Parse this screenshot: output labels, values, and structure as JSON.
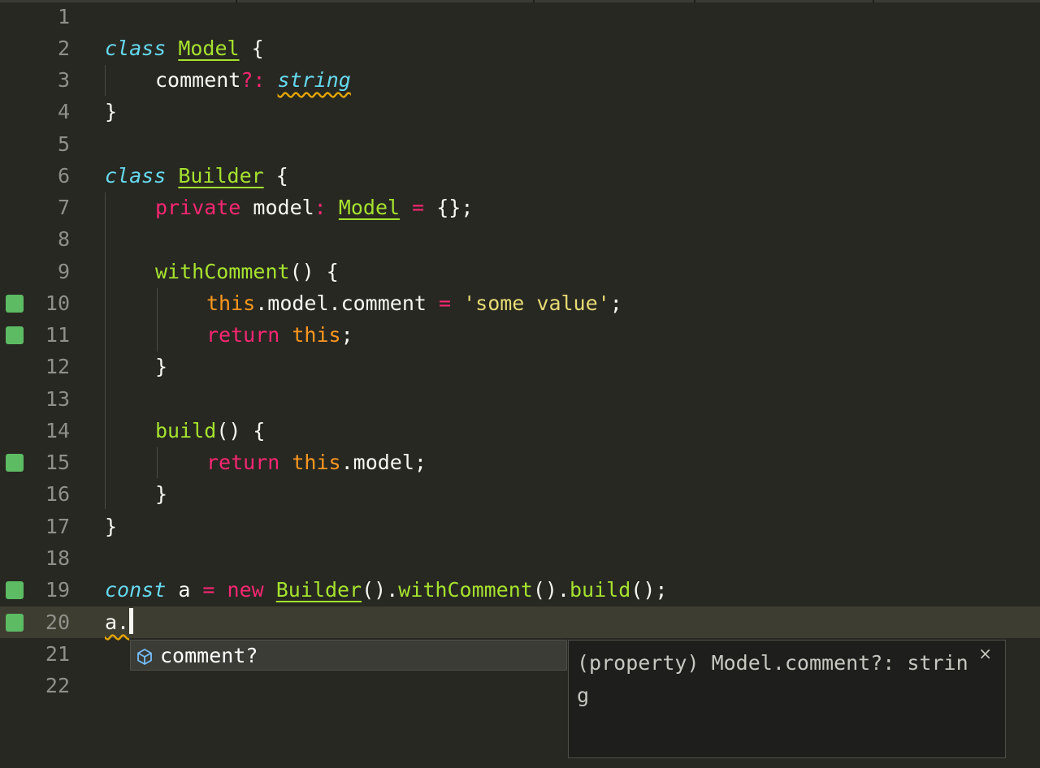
{
  "editor": {
    "line_numbers": [
      "1",
      "2",
      "3",
      "4",
      "5",
      "6",
      "7",
      "8",
      "9",
      "10",
      "11",
      "12",
      "13",
      "14",
      "15",
      "16",
      "17",
      "18",
      "19",
      "20",
      "21",
      "22"
    ],
    "tokens": {
      "class": "class",
      "model_cls": "Model",
      "brace_open": " {",
      "brace_close": "}",
      "comment_prop": "comment",
      "optional_colon": "?:",
      "space": " ",
      "string_type": "string",
      "builder_cls": "Builder",
      "private": "private",
      "model_field": " model",
      "colon": ":",
      "assign": " = ",
      "empty_obj": "{};",
      "with_comment": "withComment",
      "parens_brace": "() {",
      "this": "this",
      "dot_model_comment": ".model.comment",
      "some_value": "'some value'",
      "semicolon": ";",
      "return": "return",
      "build": "build",
      "dot_model_semi": ".model;",
      "const": "const",
      "var_a": " a",
      "new": "new",
      "call_open": "().",
      "call_close": "();",
      "a_dot": "a."
    }
  },
  "autocomplete": {
    "suggestion": "comment?",
    "icon": "property-cube-icon",
    "detail": "(property) Model.comment?: string",
    "close": "×"
  },
  "colors": {
    "background": "#272822",
    "keyword": "#f92672",
    "class_name": "#a6e22e",
    "storage": "#66d9ef",
    "string": "#e6db74",
    "this": "#fd971f",
    "changed_marker": "#5dbb63"
  }
}
